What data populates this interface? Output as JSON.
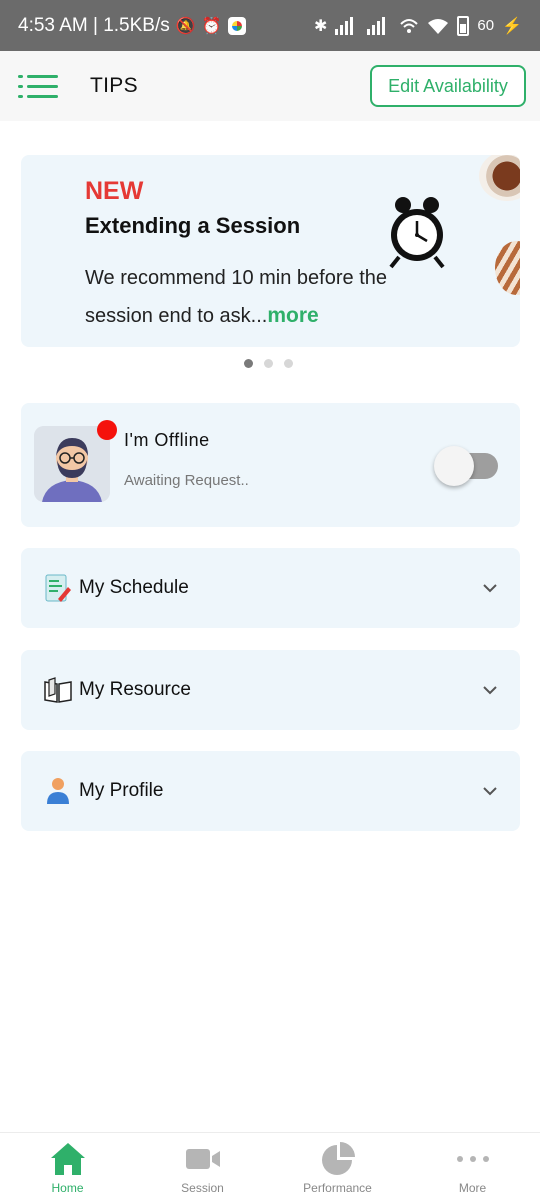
{
  "status_bar": {
    "time_speed": "4:53 AM | 1.5KB/s",
    "battery": "60"
  },
  "app_bar": {
    "title": "TIPS",
    "edit_label": "Edit Availability"
  },
  "tip": {
    "badge": "NEW",
    "title": "Extending a Session",
    "body": "We recommend 10 min before the session end to ask...",
    "more": "more",
    "pager": {
      "count": 3,
      "active": 1
    }
  },
  "status_card": {
    "title": "I'm Offline",
    "subtitle": "Awaiting Request..",
    "online": false
  },
  "sections": [
    {
      "label": "My Schedule",
      "icon": "schedule-icon"
    },
    {
      "label": "My Resource",
      "icon": "book-icon"
    },
    {
      "label": "My Profile",
      "icon": "profile-icon"
    }
  ],
  "bottom_nav": [
    {
      "label": "Home",
      "icon": "home-icon",
      "active": true
    },
    {
      "label": "Session",
      "icon": "video-icon",
      "active": false
    },
    {
      "label": "Performance",
      "icon": "pie-chart-icon",
      "active": false
    },
    {
      "label": "More",
      "icon": "more-dots-icon",
      "active": false
    }
  ],
  "colors": {
    "accent": "#2fb06a",
    "new_badge": "#e53935",
    "card_bg": "#eef6fb",
    "offline_dot": "#f5120c"
  }
}
